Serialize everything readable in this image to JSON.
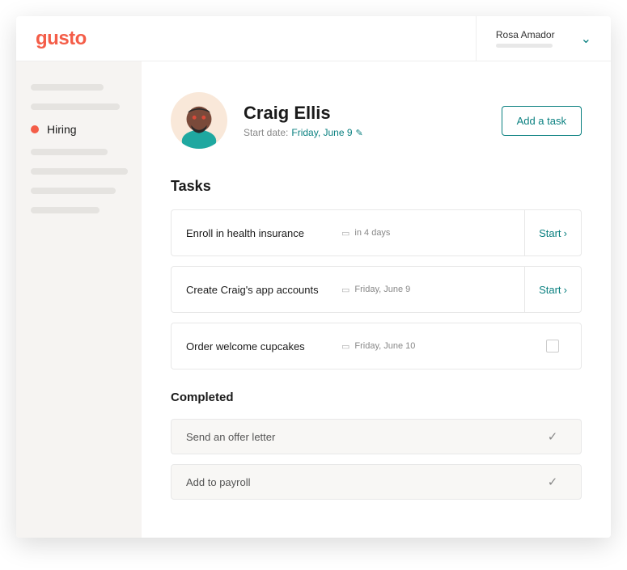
{
  "brand": "gusto",
  "user": {
    "name": "Rosa Amador"
  },
  "sidebar": {
    "active_label": "Hiring"
  },
  "profile": {
    "name": "Craig Ellis",
    "start_prefix": "Start date:",
    "start_date": "Friday, June 9"
  },
  "buttons": {
    "add_task": "Add a task"
  },
  "sections": {
    "tasks": "Tasks",
    "completed": "Completed"
  },
  "tasks": [
    {
      "title": "Enroll in health insurance",
      "due": "in 4 days",
      "action": "Start"
    },
    {
      "title": "Create Craig's app accounts",
      "due": "Friday, June 9",
      "action": "Start"
    },
    {
      "title": "Order welcome cupcakes",
      "due": "Friday, June 10",
      "action": ""
    }
  ],
  "completed": [
    {
      "title": "Send an offer letter"
    },
    {
      "title": "Add to payroll"
    }
  ]
}
